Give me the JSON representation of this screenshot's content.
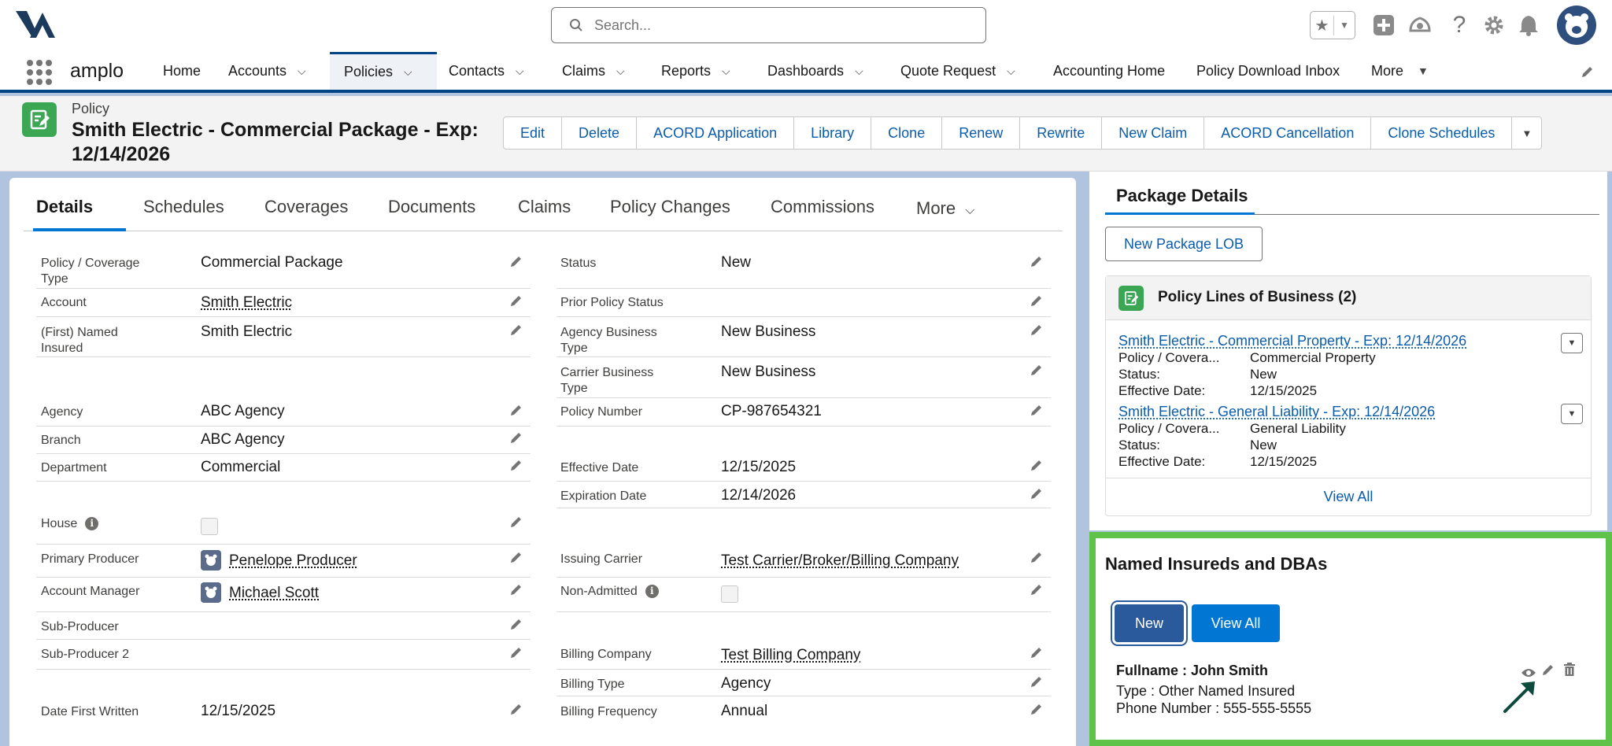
{
  "global_header": {
    "search_placeholder": "Search..."
  },
  "app_nav": {
    "app_name": "amplo",
    "items": [
      {
        "label": "Home",
        "has_menu": false
      },
      {
        "label": "Accounts",
        "has_menu": true
      },
      {
        "label": "Policies",
        "has_menu": true,
        "active": true
      },
      {
        "label": "Contacts",
        "has_menu": true
      },
      {
        "label": "Claims",
        "has_menu": true
      },
      {
        "label": "Reports",
        "has_menu": true
      },
      {
        "label": "Dashboards",
        "has_menu": true
      },
      {
        "label": "Quote Request",
        "has_menu": true
      },
      {
        "label": "Accounting Home",
        "has_menu": false
      },
      {
        "label": "Policy Download Inbox",
        "has_menu": false
      },
      {
        "label": "More",
        "has_menu": true
      }
    ]
  },
  "record": {
    "type": "Policy",
    "title": "Smith Electric - Commercial Package - Exp: 12/14/2026",
    "actions": [
      "Edit",
      "Delete",
      "ACORD Application",
      "Library",
      "Clone",
      "Renew",
      "Rewrite",
      "New Claim",
      "ACORD Cancellation",
      "Clone Schedules"
    ]
  },
  "tabs": [
    "Details",
    "Schedules",
    "Coverages",
    "Documents",
    "Claims",
    "Policy Changes",
    "Commissions",
    "More"
  ],
  "details_left": [
    {
      "label": "Policy / Coverage Type",
      "value": "Commercial Package"
    },
    {
      "label": "Account",
      "value": "Smith Electric",
      "link": true
    },
    {
      "label": "(First) Named Insured",
      "value": "Smith Electric"
    },
    {
      "label": "Agency",
      "value": "ABC Agency"
    },
    {
      "label": "Branch",
      "value": "ABC Agency"
    },
    {
      "label": "Department",
      "value": "Commercial"
    },
    {
      "label": "House",
      "value": ""
    },
    {
      "label": "Primary Producer",
      "value": "Penelope Producer",
      "link": true
    },
    {
      "label": "Account Manager",
      "value": "Michael Scott",
      "link": true
    },
    {
      "label": "Sub-Producer",
      "value": ""
    },
    {
      "label": "Sub-Producer 2",
      "value": ""
    },
    {
      "label": "Date First Written",
      "value": "12/15/2025"
    }
  ],
  "details_right": [
    {
      "label": "Status",
      "value": "New"
    },
    {
      "label": "Prior Policy Status",
      "value": ""
    },
    {
      "label": "Agency Business Type",
      "value": "New Business"
    },
    {
      "label": "Carrier Business Type",
      "value": "New Business"
    },
    {
      "label": "Policy Number",
      "value": "CP-987654321"
    },
    {
      "label": "Effective Date",
      "value": "12/15/2025"
    },
    {
      "label": "Expiration Date",
      "value": "12/14/2026"
    },
    {
      "label": "Issuing Carrier",
      "value": "Test Carrier/Broker/Billing Company",
      "link": true
    },
    {
      "label": "Non-Admitted",
      "value": ""
    },
    {
      "label": "Billing Company",
      "value": "Test Billing Company",
      "link": true
    },
    {
      "label": "Billing Type",
      "value": "Agency"
    },
    {
      "label": "Billing Frequency",
      "value": "Annual"
    }
  ],
  "package": {
    "title": "Package Details",
    "new_button": "New Package LOB",
    "lob_title": "Policy Lines of Business (2)",
    "lines": [
      {
        "title": "Smith Electric - Commercial Property - Exp: 12/14/2026",
        "coverage_label": "Policy / Covera...",
        "coverage": "Commercial Property",
        "status_label": "Status:",
        "status": "New",
        "eff_label": "Effective Date:",
        "eff": "12/15/2025"
      },
      {
        "title": "Smith Electric - General Liability - Exp: 12/14/2026",
        "coverage_label": "Policy / Covera...",
        "coverage": "General Liability",
        "status_label": "Status:",
        "status": "New",
        "eff_label": "Effective Date:",
        "eff": "12/15/2025"
      }
    ],
    "view_all": "View All"
  },
  "named_insureds": {
    "title": "Named Insureds and DBAs",
    "new_button": "New",
    "view_all_button": "View All",
    "fullname": "Fullname : John Smith",
    "type": "Type : Other Named Insured",
    "phone": "Phone Number : 555-555-5555"
  },
  "colors": {
    "brand": "#0176d3",
    "nav_bar_border": "#014486",
    "highlight_border": "#5fc34a",
    "record_icon": "#3ba755"
  }
}
